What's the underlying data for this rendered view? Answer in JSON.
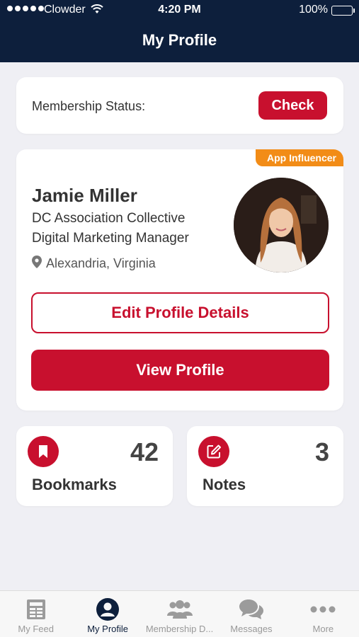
{
  "status_bar": {
    "carrier": "Clowder",
    "time": "4:20 PM",
    "battery": "100%"
  },
  "header": {
    "title": "My Profile"
  },
  "membership": {
    "label": "Membership Status:",
    "check_label": "Check"
  },
  "profile": {
    "badge": "App Influencer",
    "name": "Jamie Miller",
    "organization": "DC Association Collective",
    "role": "Digital Marketing Manager",
    "location": "Alexandria, Virginia",
    "edit_label": "Edit Profile Details",
    "view_label": "View Profile"
  },
  "stats": {
    "bookmarks": {
      "count": "42",
      "label": "Bookmarks",
      "icon": "bookmark-icon"
    },
    "notes": {
      "count": "3",
      "label": "Notes",
      "icon": "edit-note-icon"
    }
  },
  "tabs": [
    {
      "label": "My Feed",
      "icon": "feed-icon",
      "active": false
    },
    {
      "label": "My Profile",
      "icon": "profile-icon",
      "active": true
    },
    {
      "label": "Membership D...",
      "icon": "group-icon",
      "active": false
    },
    {
      "label": "Messages",
      "icon": "chat-icon",
      "active": false
    },
    {
      "label": "More",
      "icon": "more-icon",
      "active": false
    }
  ],
  "colors": {
    "header": "#0d1f3c",
    "accent": "#c8102e",
    "badge": "#f28c17",
    "background": "#efeff4"
  }
}
